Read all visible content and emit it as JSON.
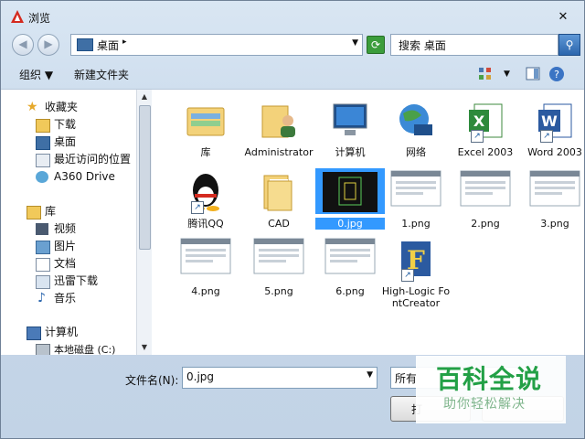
{
  "window": {
    "title": "浏览",
    "close_glyph": "✕"
  },
  "address": {
    "location": "桌面",
    "search_placeholder": "搜索 桌面"
  },
  "toolbar": {
    "organize": "组织",
    "new_folder": "新建文件夹"
  },
  "sidebar": {
    "favorites": {
      "label": "收藏夹",
      "items": [
        "下载",
        "桌面",
        "最近访问的位置",
        "A360 Drive"
      ]
    },
    "libraries": {
      "label": "库",
      "items": [
        "视频",
        "图片",
        "文档",
        "迅雷下载",
        "音乐"
      ]
    },
    "computer": {
      "label": "计算机",
      "items": [
        "本地磁盘 (C:)"
      ]
    }
  },
  "files": [
    {
      "name": "库",
      "icon": "library-folder-icon"
    },
    {
      "name": "Administrator",
      "icon": "user-folder-icon"
    },
    {
      "name": "计算机",
      "icon": "computer-icon"
    },
    {
      "name": "网络",
      "icon": "network-globe-icon"
    },
    {
      "name": "Excel 2003",
      "icon": "excel-icon",
      "shortcut": true
    },
    {
      "name": "Word 2003",
      "icon": "word-icon",
      "shortcut": true
    },
    {
      "name": "腾讯QQ",
      "icon": "qq-penguin-icon",
      "shortcut": true
    },
    {
      "name": "CAD",
      "icon": "folder-icon"
    },
    {
      "name": "0.jpg",
      "icon": "cad-thumbnail",
      "selected": true
    },
    {
      "name": "1.png",
      "icon": "image-thumbnail"
    },
    {
      "name": "2.png",
      "icon": "image-thumbnail"
    },
    {
      "name": "3.png",
      "icon": "image-thumbnail"
    },
    {
      "name": "4.png",
      "icon": "image-thumbnail"
    },
    {
      "name": "5.png",
      "icon": "image-thumbnail"
    },
    {
      "name": "6.png",
      "icon": "image-thumbnail"
    },
    {
      "name": "High-Logic FontCreator",
      "icon": "fontcreator-icon",
      "shortcut": true
    }
  ],
  "bottom": {
    "filename_label": "文件名(N):",
    "filename_value": "0.jpg",
    "filetype_value": "所有",
    "open_button": "打"
  },
  "watermark": {
    "title": "百科全说",
    "subtitle": "助你轻松解决"
  },
  "colors": {
    "selection": "#3399ff",
    "watermark_green": "#23a046"
  }
}
